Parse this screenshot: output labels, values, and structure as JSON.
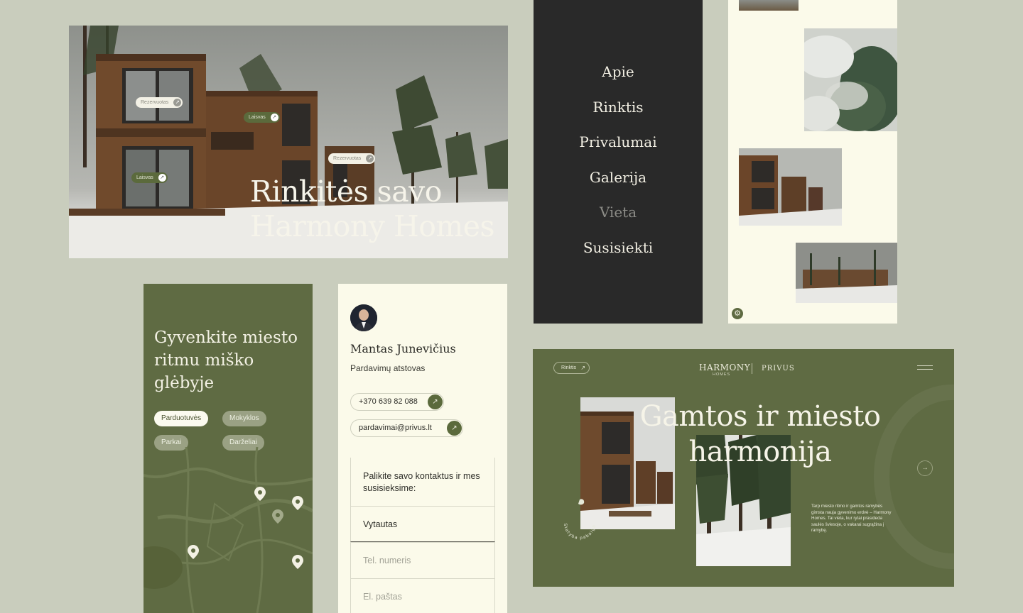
{
  "hero": {
    "title_line1": "Rinkitės savo",
    "title_line2": "Harmony Homes",
    "tags": [
      {
        "label": "Rezervuotas",
        "status": "reserved",
        "icon": "arrow-up-right-icon"
      },
      {
        "label": "Laisvas",
        "status": "available",
        "icon": "arrow-up-right-icon"
      },
      {
        "label": "Rezervuotas",
        "status": "reserved",
        "icon": "arrow-up-right-icon"
      },
      {
        "label": "Laisvas",
        "status": "available",
        "icon": "arrow-up-right-icon"
      }
    ]
  },
  "menu": {
    "items": [
      {
        "label": "Apie",
        "active": false
      },
      {
        "label": "Rinktis",
        "active": false
      },
      {
        "label": "Privalumai",
        "active": false
      },
      {
        "label": "Galerija",
        "active": false
      },
      {
        "label": "Vieta",
        "active": true
      },
      {
        "label": "Susisiekti",
        "active": false
      }
    ]
  },
  "gallery": {
    "settings_icon": "gear-icon"
  },
  "map": {
    "heading": "Gyvenkite miesto ritmu miško glėbyje",
    "filters": [
      {
        "label": "Parduotuvės",
        "selected": true
      },
      {
        "label": "Mokyklos",
        "selected": false
      },
      {
        "label": "Parkai",
        "selected": false
      },
      {
        "label": "Darželiai",
        "selected": false
      }
    ],
    "pin_icon": "map-pin-icon"
  },
  "contact": {
    "name": "Mantas Junevičius",
    "role": "Pardavimų atstovas",
    "phone": "+370 639 82 088",
    "email": "pardavimai@privus.lt",
    "form_intro": "Palikite savo kontaktus ir mes susisieksime:",
    "name_value": "Vytautas",
    "phone_placeholder": "Tel. numeris",
    "email_placeholder": "El. paštas"
  },
  "landing": {
    "button_label": "Rinktis",
    "logo_main": "HARMONY",
    "logo_sub": "HOMES",
    "logo_partner": "PRIVUS",
    "title_line1": "Gamtos ir miesto",
    "title_line2": "harmonija",
    "badge_text": "Statyba pabaiga · 2024 I ketv.",
    "description": "Tarp miesto ritmo ir gamtos ramybės gimsta nauja gyvenimo erdvė – Harmony Homes. Tai vieta, kur rytai prasideda saulės šviesoje, o vakarai sugrąžina į ramybę."
  },
  "colors": {
    "background": "#c9cdbd",
    "olive": "#5f6b43",
    "cream": "#fbfaea",
    "dark": "#292929"
  }
}
